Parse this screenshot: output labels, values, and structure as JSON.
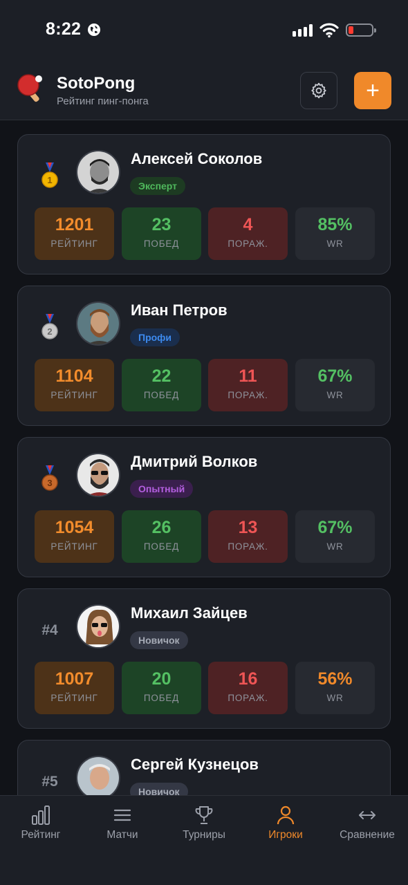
{
  "status_bar": {
    "time": "8:22"
  },
  "header": {
    "title": "SotoPong",
    "subtitle": "Рейтинг пинг-понга",
    "add_label": "+"
  },
  "labels": {
    "rating": "РЕЙТИНГ",
    "wins": "ПОБЕД",
    "losses": "ПОРАЖ.",
    "wr": "WR"
  },
  "colors": {
    "accent": "#f0892a",
    "wr_green": "#54c063",
    "wr_orange": "#f0892a"
  },
  "players": [
    {
      "rank": "1",
      "rank_icon": "gold-medal-icon",
      "name": "Алексей Соколов",
      "level": "Эксперт",
      "level_color": "#4fb85c",
      "level_bg": "#1d3b22",
      "rating": "1201",
      "wins": "23",
      "losses": "4",
      "wr": "85%",
      "wr_color": "#54c063"
    },
    {
      "rank": "2",
      "rank_icon": "silver-medal-icon",
      "name": "Иван Петров",
      "level": "Профи",
      "level_color": "#3d8bf0",
      "level_bg": "#1a2e4d",
      "rating": "1104",
      "wins": "22",
      "losses": "11",
      "wr": "67%",
      "wr_color": "#54c063"
    },
    {
      "rank": "3",
      "rank_icon": "bronze-medal-icon",
      "name": "Дмитрий Волков",
      "level": "Опытный",
      "level_color": "#b45fe0",
      "level_bg": "#3a1f4d",
      "rating": "1054",
      "wins": "26",
      "losses": "13",
      "wr": "67%",
      "wr_color": "#54c063"
    },
    {
      "rank": "#4",
      "rank_icon": "",
      "name": "Михаил Зайцев",
      "level": "Новичок",
      "level_color": "#a5aab5",
      "level_bg": "#343845",
      "rating": "1007",
      "wins": "20",
      "losses": "16",
      "wr": "56%",
      "wr_color": "#f0892a"
    },
    {
      "rank": "#5",
      "rank_icon": "",
      "name": "Сергей Кузнецов",
      "level": "Новичок",
      "level_color": "#a5aab5",
      "level_bg": "#343845",
      "rating": "",
      "wins": "",
      "losses": "",
      "wr": "",
      "wr_color": "#54c063"
    }
  ],
  "tabs": [
    {
      "label": "Рейтинг",
      "icon": "bar-chart-icon",
      "active": false
    },
    {
      "label": "Матчи",
      "icon": "list-icon",
      "active": false
    },
    {
      "label": "Турниры",
      "icon": "trophy-icon",
      "active": false
    },
    {
      "label": "Игроки",
      "icon": "user-icon",
      "active": true
    },
    {
      "label": "Сравнение",
      "icon": "compare-arrows-icon",
      "active": false
    }
  ]
}
